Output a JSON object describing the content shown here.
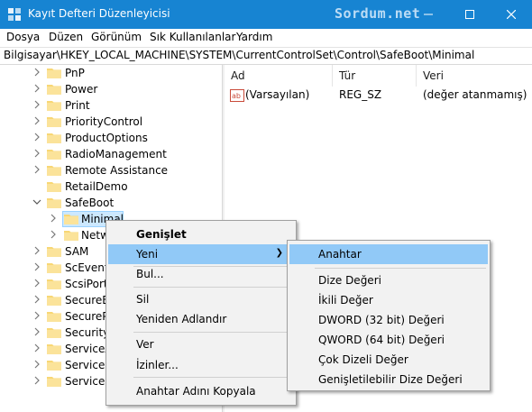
{
  "window": {
    "title": "Kayıt Defteri Düzenleyicisi",
    "watermark": "Sordum.net",
    "title_bar_color": "#1784d2"
  },
  "menu": {
    "items": [
      "Dosya",
      "Düzen",
      "Görünüm",
      "Sık Kullanılanlar",
      "Yardım"
    ]
  },
  "address": {
    "path": "Bilgisayar\\HKEY_LOCAL_MACHINE\\SYSTEM\\CurrentControlSet\\Control\\SafeBoot\\Minimal"
  },
  "tree": {
    "items": [
      {
        "label": "PnP"
      },
      {
        "label": "Power"
      },
      {
        "label": "Print"
      },
      {
        "label": "PriorityControl"
      },
      {
        "label": "ProductOptions"
      },
      {
        "label": "RadioManagement"
      },
      {
        "label": "Remote Assistance"
      },
      {
        "label": "RetailDemo"
      },
      {
        "label": "SafeBoot"
      },
      {
        "label": "Minimal"
      },
      {
        "label": "Netw"
      },
      {
        "label": "SAM"
      },
      {
        "label": "ScEvents"
      },
      {
        "label": "ScsiPort"
      },
      {
        "label": "SecureBo"
      },
      {
        "label": "SecurePi"
      },
      {
        "label": "Security"
      },
      {
        "label": "ServiceA"
      },
      {
        "label": "ServiceG"
      },
      {
        "label": "ServiceP"
      }
    ],
    "selected_color": "#cce8ff"
  },
  "list": {
    "columns": [
      "Ad",
      "Tür",
      "Veri"
    ],
    "rows": [
      {
        "name": "(Varsayılan)",
        "type": "REG_SZ",
        "data": "(değer atanmamış)"
      }
    ]
  },
  "context_menu": {
    "items": [
      "Genişlet",
      "Yeni",
      "Bul...",
      "Sil",
      "Yeniden Adlandır",
      "Ver",
      "İzinler...",
      "Anahtar Adını Kopyala"
    ]
  },
  "submenu": {
    "items": [
      "Anahtar",
      "Dize Değeri",
      "İkili Değer",
      "DWORD (32 bit) Değeri",
      "QWORD (64 bit) Değeri",
      "Çok Dizeli Değer",
      "Genişletilebilir Dize Değeri"
    ],
    "highlight_color": "#91c9f7"
  }
}
